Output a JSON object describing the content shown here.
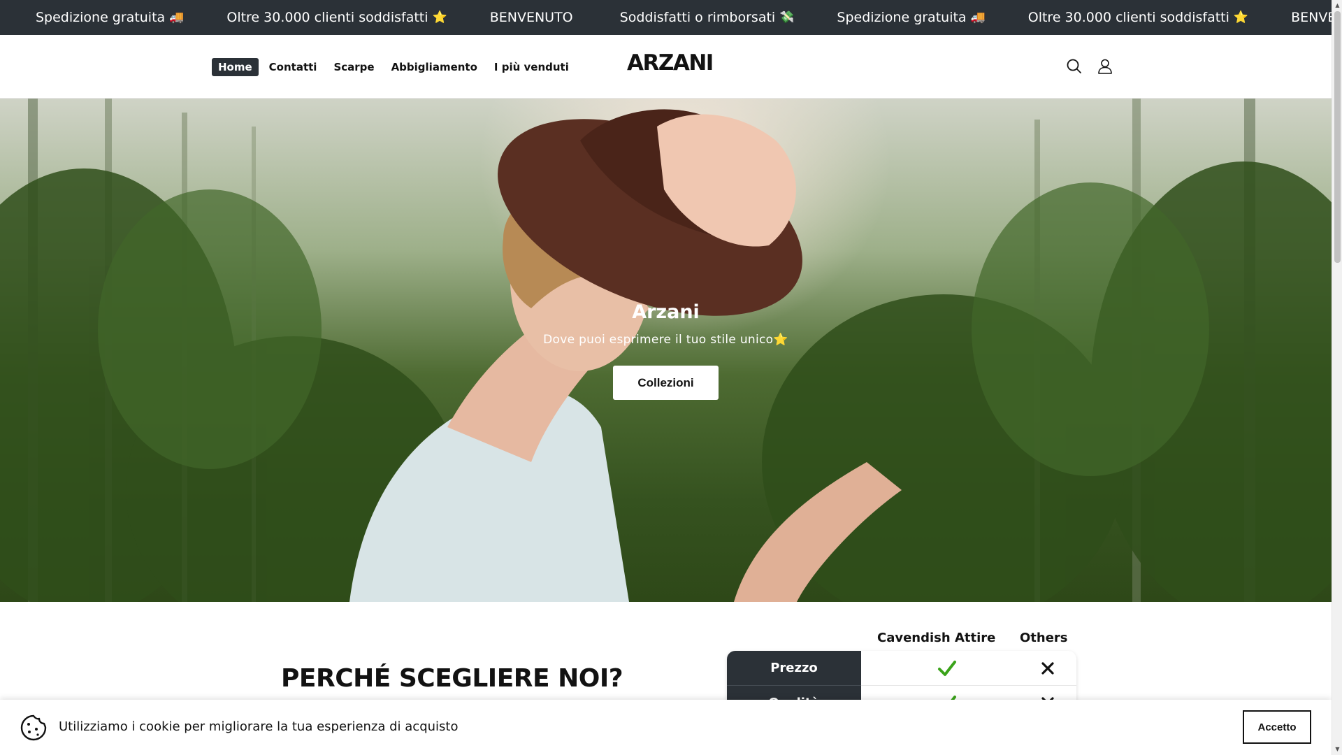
{
  "announcement": {
    "items": [
      {
        "text": "Spedizione gratuita",
        "emoji": "🚚"
      },
      {
        "text": "Oltre 30.000 clienti soddisfatti",
        "emoji": "⭐"
      },
      {
        "text": "BENVENUTO",
        "emoji": ""
      },
      {
        "text": "Soddisfatti o rimborsati",
        "emoji": "💸"
      },
      {
        "text": "Spedizione gratuita",
        "emoji": "🚚"
      },
      {
        "text": "Oltre 30.000 clienti soddisfatti",
        "emoji": "⭐"
      },
      {
        "text": "BENVENUTO",
        "emoji": ""
      }
    ]
  },
  "header": {
    "nav": [
      "Home",
      "Contatti",
      "Scarpe",
      "Abbigliamento",
      "I più venduti"
    ],
    "active_nav": "Home",
    "logo": "ARZANI",
    "icons": [
      "search-icon",
      "account-icon"
    ]
  },
  "hero": {
    "title": "Arzani",
    "subtitle": "Dove puoi esprimere il tuo stile unico⭐",
    "button_label": "Collezioni"
  },
  "why": {
    "title": "PERCHÉ SCEGLIERE NOI?",
    "columns": [
      "Cavendish Attire",
      "Others"
    ],
    "rows": [
      {
        "label": "Prezzo",
        "ours": "check",
        "others": "cross"
      },
      {
        "label": "Qualità",
        "ours": "check",
        "others": "cross"
      }
    ]
  },
  "cookie": {
    "text": "Utilizziamo i cookie per migliorare la tua esperienza di acquisto",
    "button_label": "Accetto"
  },
  "colors": {
    "dark": "#2b3137",
    "check": "#3aa31a",
    "text": "#121212"
  }
}
